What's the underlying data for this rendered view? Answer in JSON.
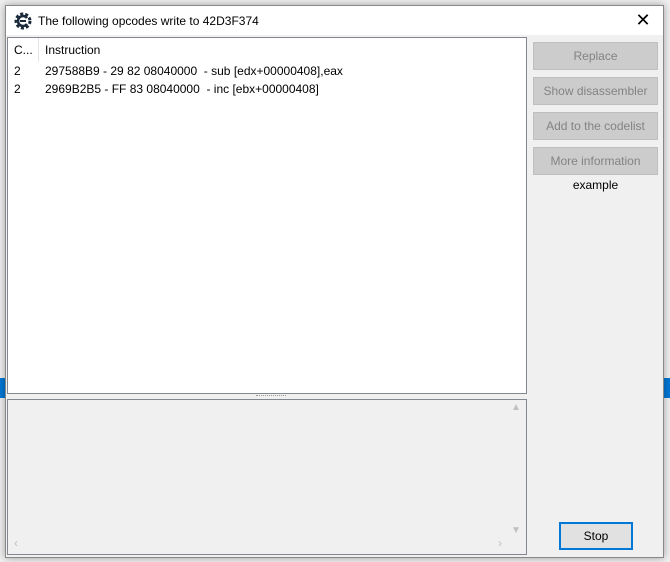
{
  "window": {
    "title": "The following opcodes write to 42D3F374",
    "close_icon": "close-icon",
    "app_icon": "cheat-engine-icon"
  },
  "list": {
    "columns": [
      "C...",
      "Instruction"
    ],
    "rows": [
      {
        "count": "2",
        "instruction": "297588B9 - 29 82 08040000  - sub [edx+00000408],eax"
      },
      {
        "count": "2",
        "instruction": "2969B2B5 - FF 83 08040000  - inc [ebx+00000408]"
      }
    ]
  },
  "buttons": {
    "replace": "Replace",
    "show_disassembler": "Show disassembler",
    "add_codelist": "Add to the codelist",
    "more_info": "More information",
    "stop": "Stop"
  },
  "example_label": "example",
  "colors": {
    "accent": "#0078d7",
    "disabled_button": "#cccccc"
  }
}
